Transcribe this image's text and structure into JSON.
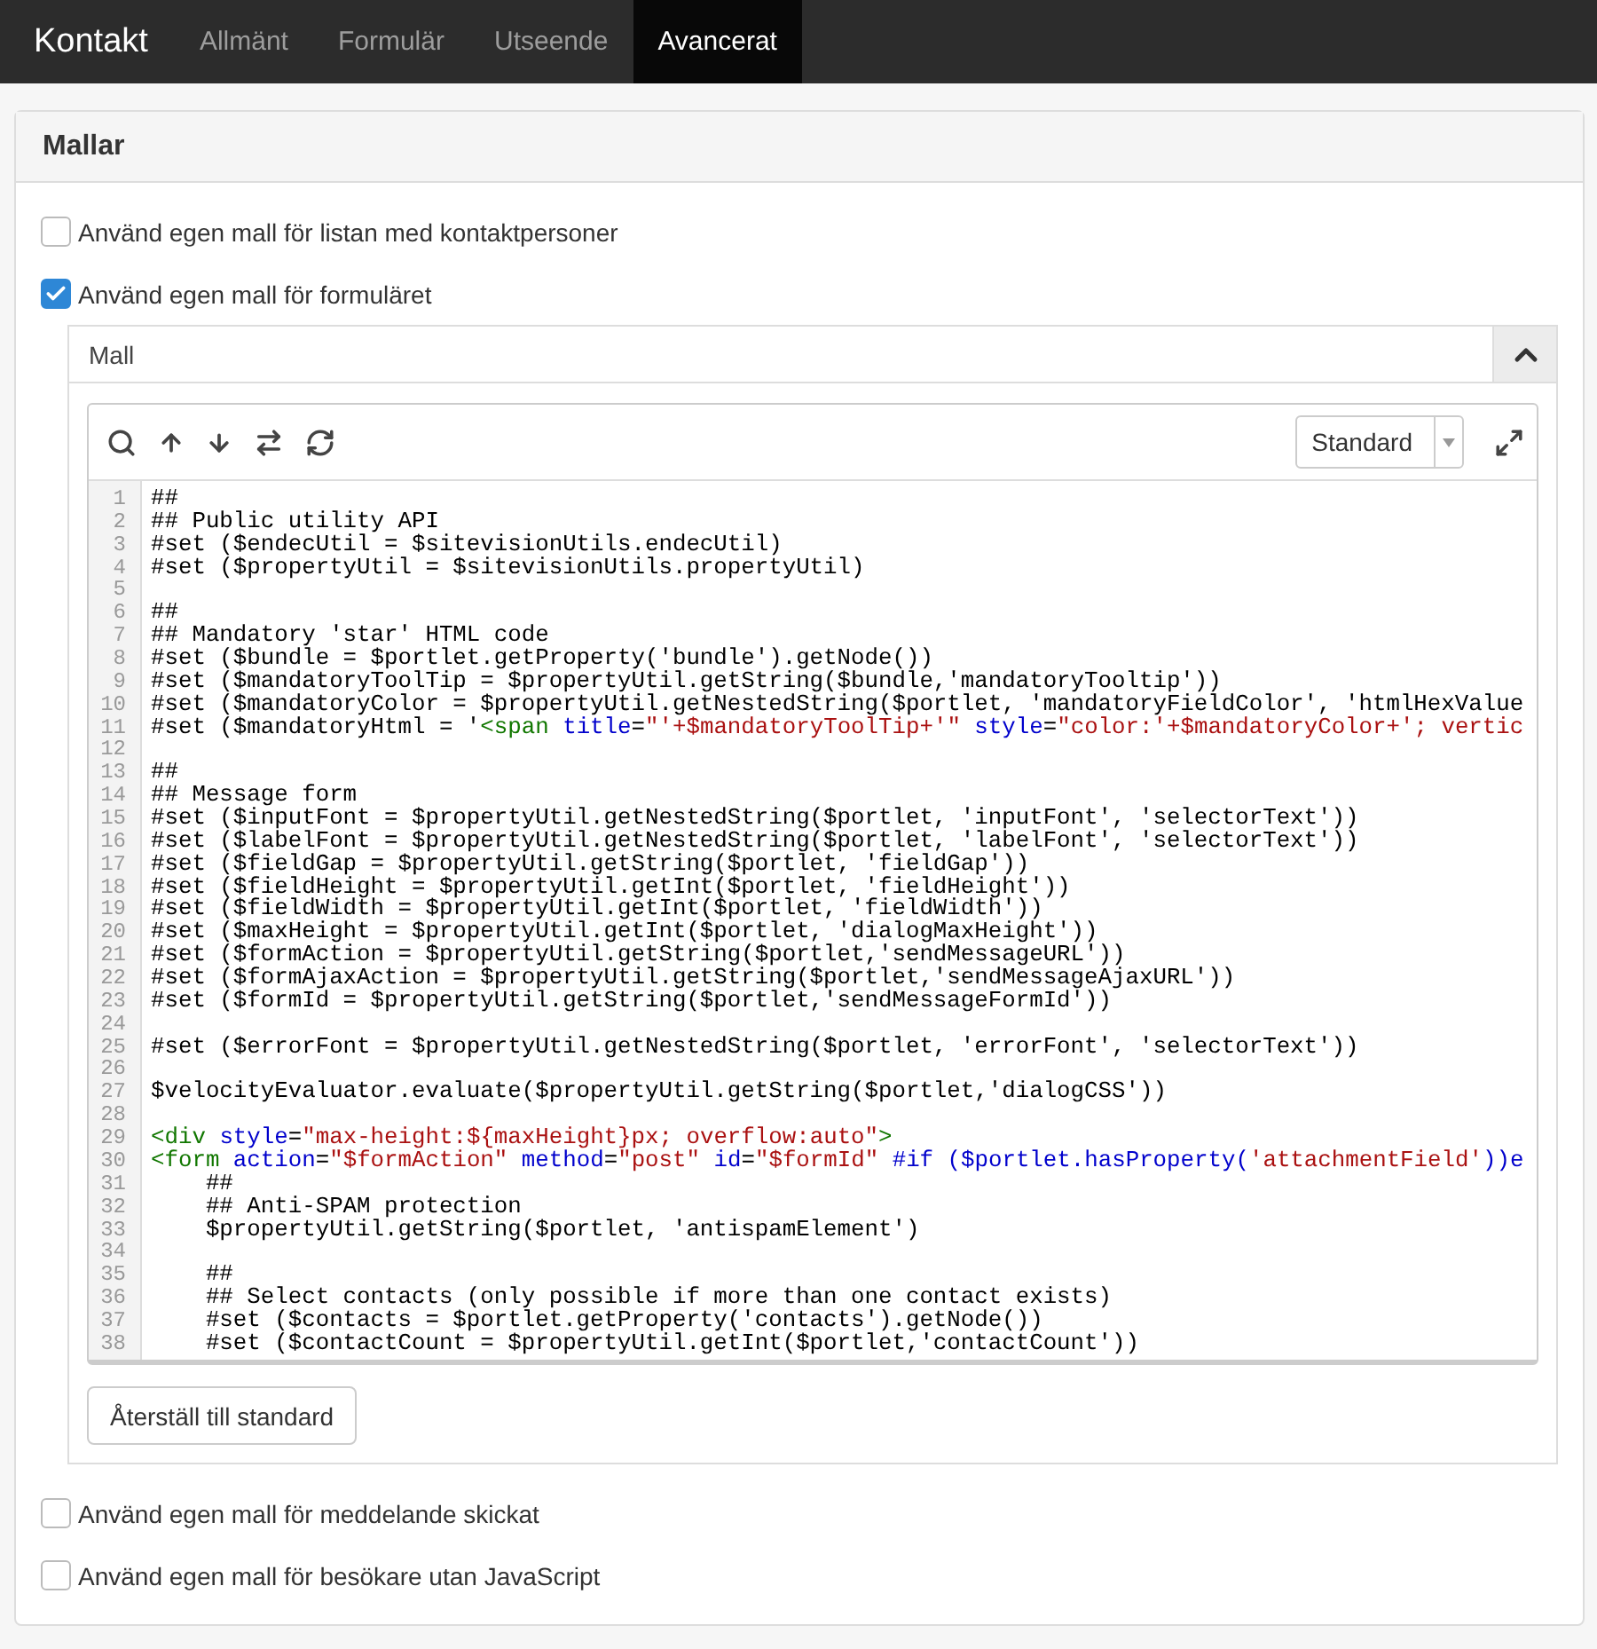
{
  "navbar": {
    "brand": "Kontakt",
    "tabs": [
      {
        "label": "Allmänt",
        "selected": false
      },
      {
        "label": "Formulär",
        "selected": false
      },
      {
        "label": "Utseende",
        "selected": false
      },
      {
        "label": "Avancerat",
        "selected": true
      }
    ]
  },
  "panel": {
    "title": "Mallar",
    "options": [
      {
        "label": "Använd egen mall för listan med kontaktpersoner",
        "checked": false
      },
      {
        "label": "Använd egen mall för formuläret",
        "checked": true,
        "template": {
          "title": "Mall",
          "expanded": true,
          "mode": "Standard",
          "reset_button": "Återställ till standard",
          "code": [
            {
              "number": "1",
              "tokens": [
                {
                  "kind": "plain",
                  "text": "##"
                }
              ]
            },
            {
              "number": "2",
              "tokens": [
                {
                  "kind": "plain",
                  "text": "## Public utility API"
                }
              ]
            },
            {
              "number": "3",
              "tokens": [
                {
                  "kind": "plain",
                  "text": "#set ($endecUtil = $sitevisionUtils.endecUtil)"
                }
              ]
            },
            {
              "number": "4",
              "tokens": [
                {
                  "kind": "plain",
                  "text": "#set ($propertyUtil = $sitevisionUtils.propertyUtil)"
                }
              ]
            },
            {
              "number": "5"
            },
            {
              "number": "6",
              "tokens": [
                {
                  "kind": "plain",
                  "text": "##"
                }
              ]
            },
            {
              "number": "7",
              "tokens": [
                {
                  "kind": "plain",
                  "text": "## Mandatory 'star' HTML code"
                }
              ]
            },
            {
              "number": "8",
              "tokens": [
                {
                  "kind": "plain",
                  "text": "#set ($bundle = $portlet.getProperty('bundle').getNode())"
                }
              ]
            },
            {
              "number": "9",
              "tokens": [
                {
                  "kind": "plain",
                  "text": "#set ($mandatoryToolTip = $propertyUtil.getString($bundle,'mandatoryTooltip'))"
                }
              ]
            },
            {
              "number": "10",
              "tokens": [
                {
                  "kind": "plain",
                  "text": "#set ($mandatoryColor = $propertyUtil.getNestedString($portlet, 'mandatoryFieldColor', 'htmlHexValue"
                }
              ]
            },
            {
              "number": "11",
              "tokens": [
                {
                  "kind": "plain",
                  "text": "#set ($mandatoryHtml = '"
                },
                {
                  "kind": "tag",
                  "text": "<span"
                },
                {
                  "kind": "attr",
                  "text": " title"
                },
                {
                  "kind": "plain",
                  "text": "="
                },
                {
                  "kind": "string",
                  "text": "\"'+$mandatoryToolTip+'\""
                },
                {
                  "kind": "attr",
                  "text": " style"
                },
                {
                  "kind": "plain",
                  "text": "="
                },
                {
                  "kind": "string",
                  "text": "\"color:'+$mandatoryColor+'; vertic"
                }
              ]
            },
            {
              "number": "12"
            },
            {
              "number": "13",
              "tokens": [
                {
                  "kind": "plain",
                  "text": "##"
                }
              ]
            },
            {
              "number": "14",
              "tokens": [
                {
                  "kind": "plain",
                  "text": "## Message form"
                }
              ]
            },
            {
              "number": "15",
              "tokens": [
                {
                  "kind": "plain",
                  "text": "#set ($inputFont = $propertyUtil.getNestedString($portlet, 'inputFont', 'selectorText'))"
                }
              ]
            },
            {
              "number": "16",
              "tokens": [
                {
                  "kind": "plain",
                  "text": "#set ($labelFont = $propertyUtil.getNestedString($portlet, 'labelFont', 'selectorText'))"
                }
              ]
            },
            {
              "number": "17",
              "tokens": [
                {
                  "kind": "plain",
                  "text": "#set ($fieldGap = $propertyUtil.getString($portlet, 'fieldGap'))"
                }
              ]
            },
            {
              "number": "18",
              "tokens": [
                {
                  "kind": "plain",
                  "text": "#set ($fieldHeight = $propertyUtil.getInt($portlet, 'fieldHeight'))"
                }
              ]
            },
            {
              "number": "19",
              "tokens": [
                {
                  "kind": "plain",
                  "text": "#set ($fieldWidth = $propertyUtil.getInt($portlet, 'fieldWidth'))"
                }
              ]
            },
            {
              "number": "20",
              "tokens": [
                {
                  "kind": "plain",
                  "text": "#set ($maxHeight = $propertyUtil.getInt($portlet, 'dialogMaxHeight'))"
                }
              ]
            },
            {
              "number": "21",
              "tokens": [
                {
                  "kind": "plain",
                  "text": "#set ($formAction = $propertyUtil.getString($portlet,'sendMessageURL'))"
                }
              ]
            },
            {
              "number": "22",
              "tokens": [
                {
                  "kind": "plain",
                  "text": "#set ($formAjaxAction = $propertyUtil.getString($portlet,'sendMessageAjaxURL'))"
                }
              ]
            },
            {
              "number": "23",
              "tokens": [
                {
                  "kind": "plain",
                  "text": "#set ($formId = $propertyUtil.getString($portlet,'sendMessageFormId'))"
                }
              ]
            },
            {
              "number": "24"
            },
            {
              "number": "25",
              "tokens": [
                {
                  "kind": "plain",
                  "text": "#set ($errorFont = $propertyUtil.getNestedString($portlet, 'errorFont', 'selectorText'))"
                }
              ]
            },
            {
              "number": "26"
            },
            {
              "number": "27",
              "tokens": [
                {
                  "kind": "plain",
                  "text": "$velocityEvaluator.evaluate($propertyUtil.getString($portlet,'dialogCSS'))"
                }
              ]
            },
            {
              "number": "28"
            },
            {
              "number": "29",
              "tokens": [
                {
                  "kind": "tag",
                  "text": "<div"
                },
                {
                  "kind": "attr",
                  "text": " style"
                },
                {
                  "kind": "plain",
                  "text": "="
                },
                {
                  "kind": "string",
                  "text": "\"max-height:${maxHeight}px; overflow:auto\""
                },
                {
                  "kind": "tag",
                  "text": ">"
                }
              ]
            },
            {
              "number": "30",
              "tokens": [
                {
                  "kind": "tag",
                  "text": "<form"
                },
                {
                  "kind": "attr",
                  "text": " action"
                },
                {
                  "kind": "plain",
                  "text": "="
                },
                {
                  "kind": "string",
                  "text": "\"$formAction\""
                },
                {
                  "kind": "attr",
                  "text": " method"
                },
                {
                  "kind": "plain",
                  "text": "="
                },
                {
                  "kind": "string",
                  "text": "\"post\""
                },
                {
                  "kind": "attr",
                  "text": " id"
                },
                {
                  "kind": "plain",
                  "text": "="
                },
                {
                  "kind": "string",
                  "text": "\"$formId\""
                },
                {
                  "kind": "attr",
                  "text": " #if ($portlet.hasProperty("
                },
                {
                  "kind": "string",
                  "text": "'attachmentField'"
                },
                {
                  "kind": "attr",
                  "text": "))e"
                }
              ]
            },
            {
              "number": "31",
              "tokens": [
                {
                  "kind": "plain",
                  "text": "    ##"
                }
              ]
            },
            {
              "number": "32",
              "tokens": [
                {
                  "kind": "plain",
                  "text": "    ## Anti-SPAM protection"
                }
              ]
            },
            {
              "number": "33",
              "tokens": [
                {
                  "kind": "plain",
                  "text": "    $propertyUtil.getString($portlet, 'antispamElement')"
                }
              ]
            },
            {
              "number": "34"
            },
            {
              "number": "35",
              "tokens": [
                {
                  "kind": "plain",
                  "text": "    ##"
                }
              ]
            },
            {
              "number": "36",
              "tokens": [
                {
                  "kind": "plain",
                  "text": "    ## Select contacts (only possible if more than one contact exists)"
                }
              ]
            },
            {
              "number": "37",
              "tokens": [
                {
                  "kind": "plain",
                  "text": "    #set ($contacts = $portlet.getProperty('contacts').getNode())"
                }
              ]
            },
            {
              "number": "38",
              "tokens": [
                {
                  "kind": "plain",
                  "text": "    #set ($contactCount = $propertyUtil.getInt($portlet,'contactCount'))"
                }
              ]
            }
          ]
        }
      },
      {
        "label": "Använd egen mall för meddelande skickat",
        "checked": false
      },
      {
        "label": "Använd egen mall för besökare utan JavaScript",
        "checked": false
      }
    ]
  }
}
